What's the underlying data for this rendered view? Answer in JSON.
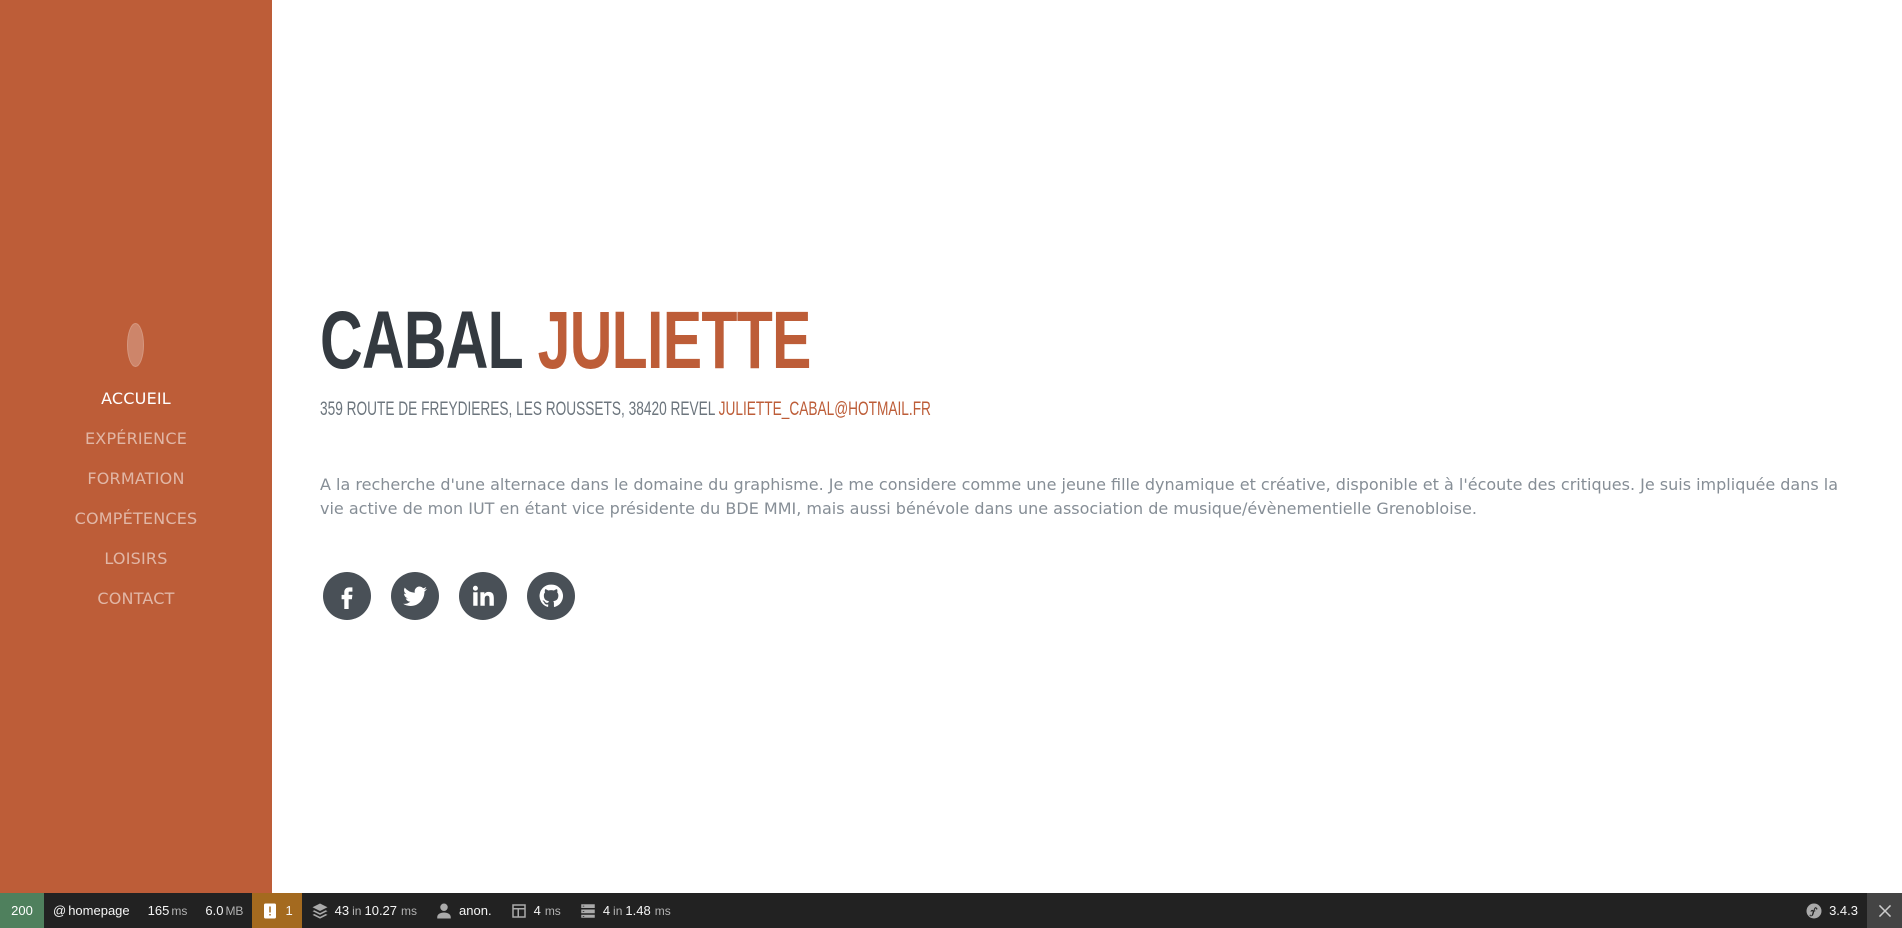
{
  "sidebar": {
    "nav": [
      {
        "label": "Accueil",
        "active": true
      },
      {
        "label": "Expérience"
      },
      {
        "label": "Formation"
      },
      {
        "label": "Compétences"
      },
      {
        "label": "Loisirs"
      },
      {
        "label": "Contact"
      }
    ]
  },
  "about": {
    "last_name": "Cabal",
    "first_name": "Juliette",
    "address": "359 route de freydieres, les Roussets, 38420 revel",
    "email": "juliette_cabal@hotmail.fr",
    "description": "A la recherche d'une alternace dans le domaine du graphisme. Je me considere comme une jeune fille dynamique et créative, disponible et à l'écoute des critiques. Je suis impliquée dans la vie active de mon IUT en étant vice présidente du BDE MMI, mais aussi bénévole dans une association de musique/évènementielle Grenobloise.",
    "social": [
      "facebook-icon",
      "twitter-icon",
      "linkedin-icon",
      "github-icon"
    ]
  },
  "toolbar": {
    "status_code": "200",
    "route_prefix": "@",
    "route": "homepage",
    "time_value": "165",
    "time_unit": "ms",
    "memory_value": "6.0",
    "memory_unit": "MB",
    "warnings": "1",
    "db_queries": "43",
    "db_in": "in",
    "db_time": "10.27",
    "db_unit": "ms",
    "user": "anon.",
    "twig_time": "4",
    "twig_unit": "ms",
    "cache_calls": "4",
    "cache_in": "in",
    "cache_time": "1.48",
    "cache_unit": "ms",
    "symfony_version": "3.4.3"
  },
  "colors": {
    "accent": "#bd5d38",
    "heading": "#343a40",
    "text_muted": "#868e96",
    "status_ok": "#4f805d",
    "warning": "#a46a1f",
    "toolbar_bg": "#222222"
  }
}
